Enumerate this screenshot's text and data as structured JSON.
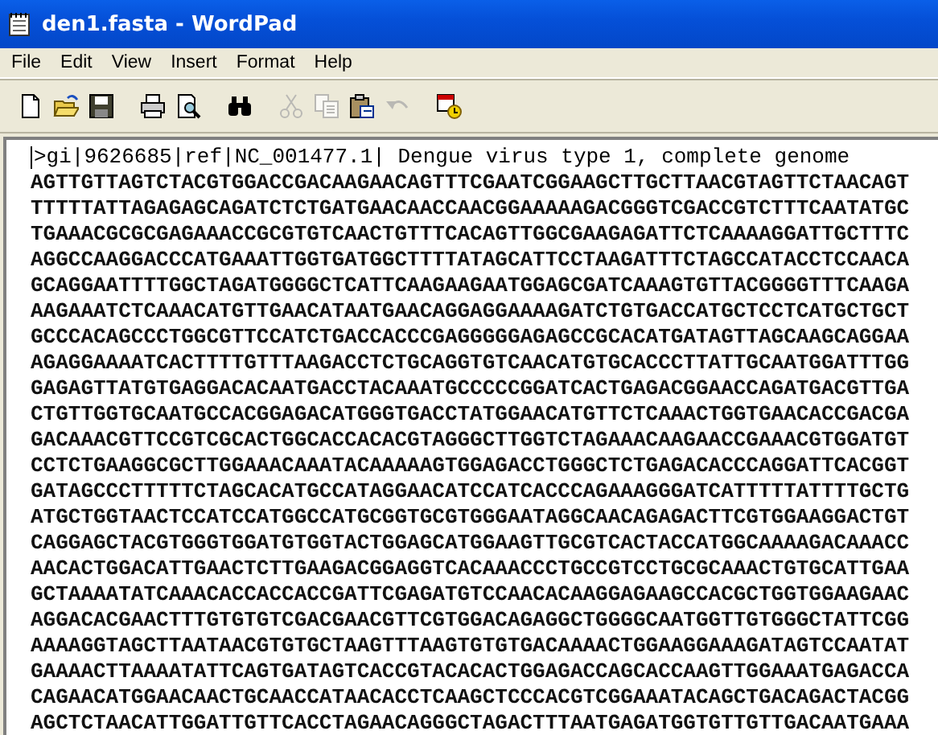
{
  "window": {
    "title": "den1.fasta - WordPad"
  },
  "menu": [
    "File",
    "Edit",
    "View",
    "Insert",
    "Format",
    "Help"
  ],
  "toolbar": [
    {
      "kind": "new",
      "disabled": false
    },
    {
      "kind": "open",
      "disabled": false
    },
    {
      "kind": "save",
      "disabled": false
    },
    {
      "kind": "print",
      "disabled": false
    },
    {
      "kind": "preview",
      "disabled": false
    },
    {
      "kind": "find",
      "disabled": false
    },
    {
      "kind": "cut",
      "disabled": true
    },
    {
      "kind": "copy",
      "disabled": true
    },
    {
      "kind": "paste",
      "disabled": false
    },
    {
      "kind": "undo",
      "disabled": true
    },
    {
      "kind": "datetime",
      "disabled": false
    }
  ],
  "document": {
    "header": ">gi|9626685|ref|NC_001477.1| Dengue virus type 1, complete genome",
    "lines": [
      "AGTTGTTAGTCTACGTGGACCGACAAGAACAGTTTCGAATCGGAAGCTTGCTTAACGTAGTTCTAACAGT",
      "TTTTTATTAGAGAGCAGATCTCTGATGAACAACCAACGGAAAAAGACGGGTCGACCGTCTTTCAATATGC",
      "TGAAACGCGCGAGAAACCGCGTGTCAACTGTTTCACAGTTGGCGAAGAGATTCTCAAAAGGATTGCTTTC",
      "AGGCCAAGGACCCATGAAATTGGTGATGGCTTTTATAGCATTCCTAAGATTTCTAGCCATACCTCCAACA",
      "GCAGGAATTTTGGCTAGATGGGGCTCATTCAAGAAGAATGGAGCGATCAAAGTGTTACGGGGTTTCAAGA",
      "AAGAAATCTCAAACATGTTGAACATAATGAACAGGAGGAAAAGATCTGTGACCATGCTCCTCATGCTGCT",
      "GCCCACAGCCCTGGCGTTCCATCTGACCACCCGAGGGGGAGAGCCGCACATGATAGTTAGCAAGCAGGAA",
      "AGAGGAAAATCACTTTTGTTTAAGACCTCTGCAGGTGTCAACATGTGCACCCTTATTGCAATGGATTTGG",
      "GAGAGTTATGTGAGGACACAATGACCTACAAATGCCCCCGGATCACTGAGACGGAACCAGATGACGTTGA",
      "CTGTTGGTGCAATGCCACGGAGACATGGGTGACCTATGGAACATGTTCTCAAACTGGTGAACACCGACGA",
      "GACAAACGTTCCGTCGCACTGGCACCACACGTAGGGCTTGGTCTAGAAACAAGAACCGAAACGTGGATGT",
      "CCTCTGAAGGCGCTTGGAAACAAATACAAAAAGTGGAGACCTGGGCTCTGAGACACCCAGGATTCACGGT",
      "GATAGCCCTTTTTCTAGCACATGCCATAGGAACATCCATCACCCAGAAAGGGATCATTTTTATTTTGCTG",
      "ATGCTGGTAACTCCATCCATGGCCATGCGGTGCGTGGGAATAGGCAACAGAGACTTCGTGGAAGGACTGT",
      "CAGGAGCTACGTGGGTGGATGTGGTACTGGAGCATGGAAGTTGCGTCACTACCATGGCAAAAGACAAACC",
      "AACACTGGACATTGAACTCTTGAAGACGGAGGTCACAAACCCTGCCGTCCTGCGCAAACTGTGCATTGAA",
      "GCTAAAATATCAAACACCACCACCGATTCGAGATGTCCAACACAAGGAGAAGCCACGCTGGTGGAAGAAC",
      "AGGACACGAACTTTGTGTGTCGACGAACGTTCGTGGACAGAGGCTGGGGCAATGGTTGTGGGCTATTCGG",
      "AAAAGGTAGCTTAATAACGTGTGCTAAGTTTAAGTGTGTGACAAAACTGGAAGGAAAGATAGTCCAATAT",
      "GAAAACTTAAAATATTCAGTGATAGTCACCGTACACACTGGAGACCAGCACCAAGTTGGAAATGAGACCA",
      "CAGAACATGGAACAACTGCAACCATAACACCTCAAGCTCCCACGTCGGAAATACAGCTGACAGACTACGG",
      "AGCTCTAACATTGGATTGTTCACCTAGAACAGGGCTAGACTTTAATGAGATGGTGTTGTTGACAATGAAA"
    ]
  }
}
